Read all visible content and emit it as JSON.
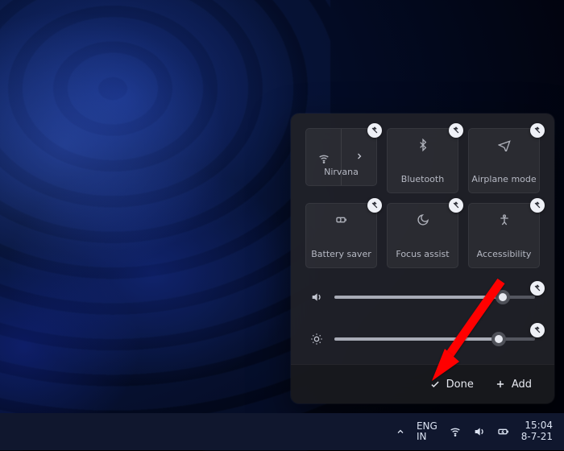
{
  "panel": {
    "tiles": [
      {
        "id": "wifi",
        "label": "Nirvana",
        "icon": "wifi"
      },
      {
        "id": "bluetooth",
        "label": "Bluetooth",
        "icon": "bluetooth"
      },
      {
        "id": "airplane",
        "label": "Airplane mode",
        "icon": "airplane"
      },
      {
        "id": "battery",
        "label": "Battery saver",
        "icon": "battery"
      },
      {
        "id": "focus",
        "label": "Focus assist",
        "icon": "moon"
      },
      {
        "id": "accessibility",
        "label": "Accessibility",
        "icon": "person"
      }
    ],
    "sliders": {
      "volume": {
        "percent": 84
      },
      "brightness": {
        "percent": 82
      }
    },
    "buttons": {
      "done": "Done",
      "add": "Add"
    }
  },
  "taskbar": {
    "lang1": "ENG",
    "lang2": "IN",
    "time": "15:04",
    "date": "8-7-21"
  }
}
